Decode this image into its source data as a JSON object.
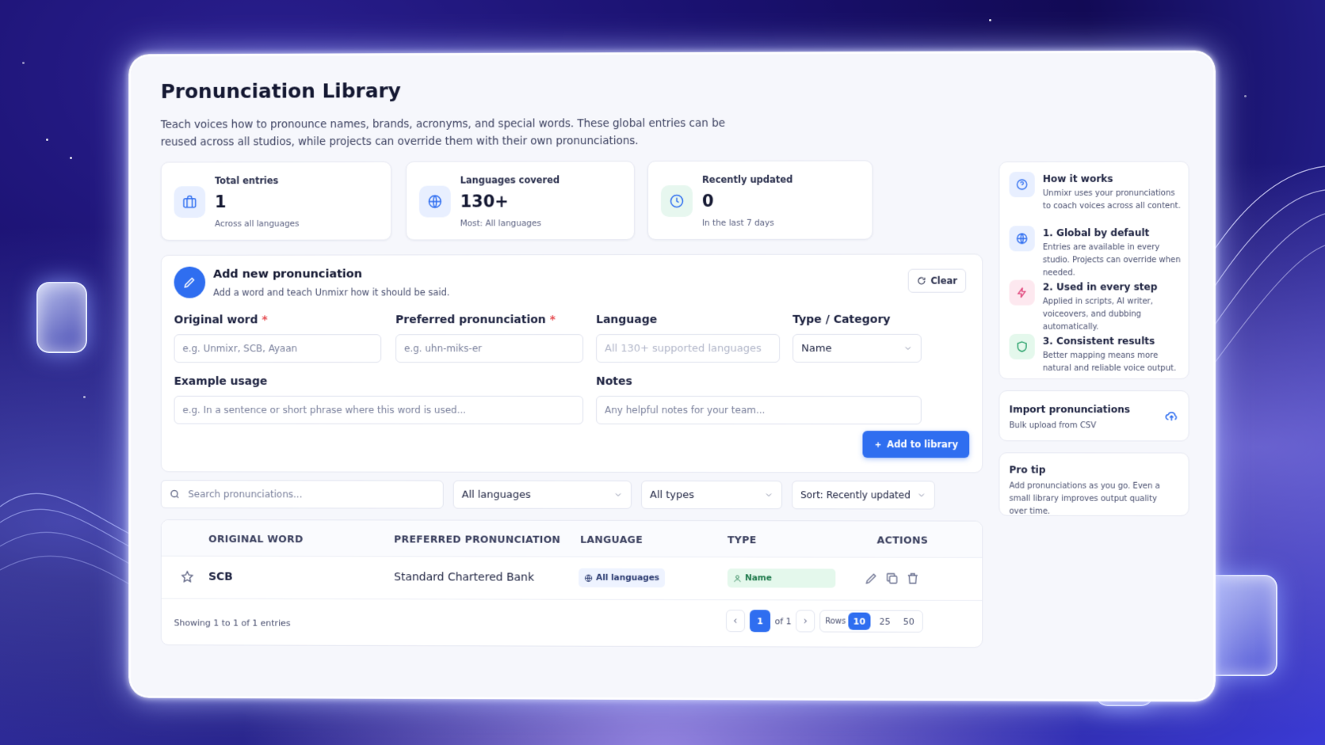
{
  "page": {
    "title": "Pronunciation Library",
    "subtitle": "Teach voices how to pronounce names, brands, acronyms, and special words. These global entries can be reused across all studios, while projects can override them with their own pronunciations."
  },
  "stats": [
    {
      "label": "Total entries",
      "value": "1",
      "sub": "Across all languages",
      "icon": "briefcase-icon"
    },
    {
      "label": "Languages covered",
      "value": "130+",
      "sub": "Most: All languages",
      "icon": "globe-icon"
    },
    {
      "label": "Recently updated",
      "value": "0",
      "sub": "In the last 7 days",
      "icon": "clock-icon"
    }
  ],
  "form": {
    "title": "Add new pronunciation",
    "subtitle": "Add a word and teach Unmixr how it should be said.",
    "clear_label": "Clear",
    "original_word_label": "Original word",
    "original_word_placeholder": "e.g. Unmixr, SCB, Ayaan",
    "preferred_label": "Preferred pronunciation",
    "preferred_placeholder": "e.g. uhn-miks-er",
    "language_label": "Language",
    "language_placeholder": "All 130+ supported languages",
    "type_label": "Type / Category",
    "type_value": "Name",
    "example_label": "Example usage",
    "example_placeholder": "e.g. In a sentence or short phrase where this word is used...",
    "notes_label": "Notes",
    "notes_placeholder": "Any helpful notes for your team...",
    "add_label": "Add to library",
    "required_mark": "*"
  },
  "filters": {
    "search_placeholder": "Search pronunciations...",
    "language": "All languages",
    "type": "All types",
    "sort": "Sort: Recently updated"
  },
  "table": {
    "headers": [
      "ORIGINAL WORD",
      "PREFERRED PRONUNCIATION",
      "LANGUAGE",
      "TYPE",
      "ACTIONS"
    ],
    "rows": [
      {
        "word": "SCB",
        "pronunciation": "Standard Chartered Bank",
        "language": "All languages",
        "type": "Name"
      }
    ],
    "showing": "Showing 1 to 1 of 1 entries",
    "page": "1",
    "of_pages": "of 1",
    "rows_label": "Rows",
    "row_options": [
      "10",
      "25",
      "50"
    ]
  },
  "sidebar": {
    "how": [
      {
        "title": "How it works",
        "text": "Unmixr uses your pronunciations to coach voices across all content.",
        "icon": "question-icon",
        "color": "#2f6ef0"
      },
      {
        "title": "1. Global by default",
        "text": "Entries are available in every studio. Projects can override when needed.",
        "icon": "globe-icon",
        "color": "#2f6ef0"
      },
      {
        "title": "2. Used in every step",
        "text": "Applied in scripts, AI writer, voiceovers, and dubbing automatically.",
        "icon": "bolt-icon",
        "color": "#e0457b"
      },
      {
        "title": "3. Consistent results",
        "text": "Better mapping means more natural and reliable voice output.",
        "icon": "shield-icon",
        "color": "#1f9d64"
      }
    ],
    "import_title": "Import pronunciations",
    "import_sub": "Bulk upload from CSV",
    "tip_title": "Pro tip",
    "tip_text": "Add pronunciations as you go. Even a small library improves output quality over time."
  }
}
